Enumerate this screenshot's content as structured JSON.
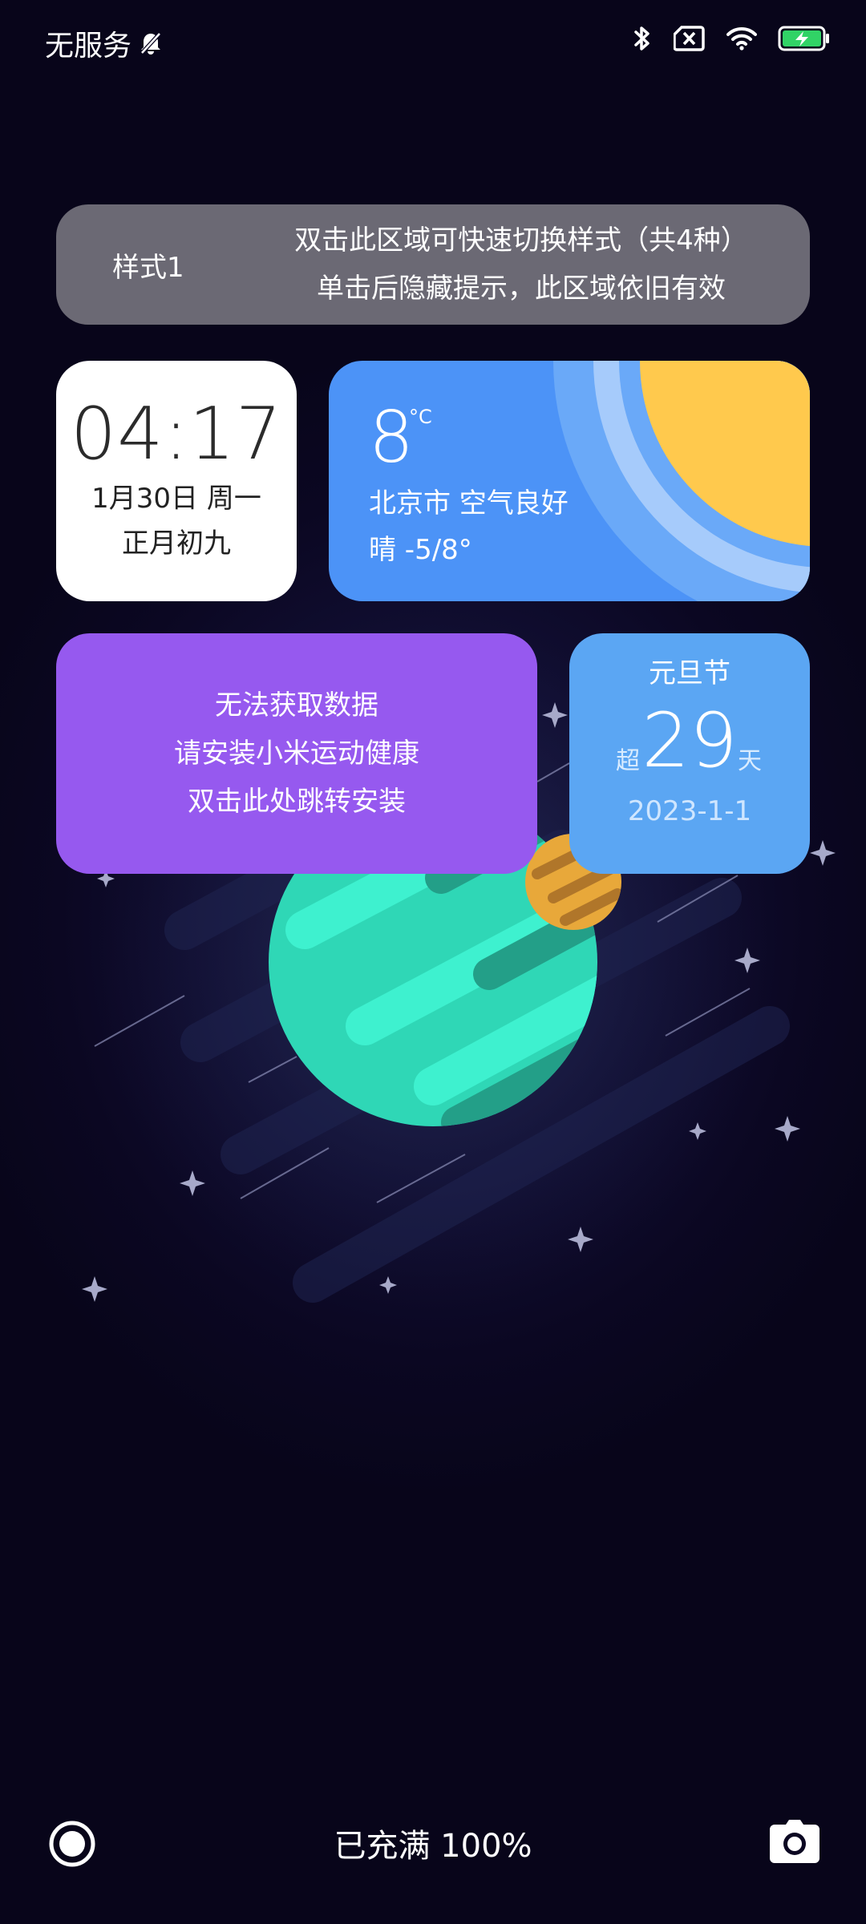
{
  "status_bar": {
    "carrier": "无服务",
    "icons": [
      "bell-off-icon",
      "bluetooth-icon",
      "no-sim-icon",
      "wifi-icon",
      "battery-charging-icon"
    ]
  },
  "hint": {
    "style_label": "样式1",
    "line1": "双击此区域可快速切换样式（共4种）",
    "line2": "单击后隐藏提示，此区域依旧有效"
  },
  "clock": {
    "time": "04:17",
    "date": "1月30日 周一",
    "lunar": "正月初九"
  },
  "weather": {
    "temp": "8",
    "unit": "°C",
    "city_air": "北京市  空气良好",
    "condition": "晴  -5/8°"
  },
  "health": {
    "line1": "无法获取数据",
    "line2": "请安装小米运动健康",
    "line3": "双击此处跳转安装"
  },
  "holiday": {
    "name": "元旦节",
    "prefix": "超",
    "days": "29",
    "suffix": "天",
    "date": "2023-1-1"
  },
  "bottom": {
    "charge_status": "已充满 100%",
    "left_icon": "circle-ring-icon",
    "right_icon": "camera-icon"
  },
  "colors": {
    "background": "#0b0722",
    "hint_bg": "#6b6974",
    "weather_bg": "#4c93f7",
    "health_bg": "#9659ef",
    "holiday_bg": "#5ba6f3",
    "planet": "#2fd7b6",
    "moon": "#e8a83a",
    "sun": "#ffc94d"
  }
}
